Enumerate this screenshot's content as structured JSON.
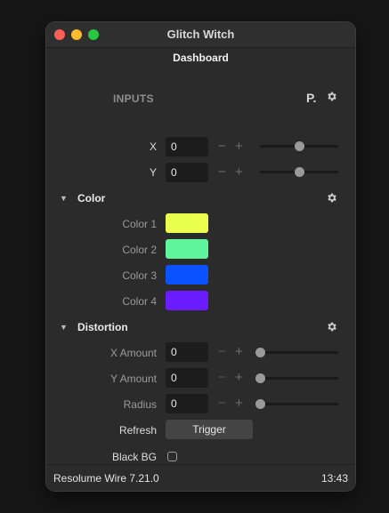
{
  "window": {
    "title": "Glitch Witch"
  },
  "tab": {
    "title": "Dashboard"
  },
  "inputs": {
    "header": "INPUTS",
    "p_label": "P.",
    "x": {
      "label": "X",
      "value": "0",
      "minus": "−",
      "plus": "+",
      "slider_fraction": 0.5
    },
    "y": {
      "label": "Y",
      "value": "0",
      "minus": "−",
      "plus": "+",
      "slider_fraction": 0.5
    }
  },
  "color_section": {
    "title": "Color",
    "items": [
      {
        "label": "Color 1",
        "color": "#ebff4d"
      },
      {
        "label": "Color 2",
        "color": "#5ff59a"
      },
      {
        "label": "Color 3",
        "color": "#0a52ff"
      },
      {
        "label": "Color 4",
        "color": "#6a1cff"
      }
    ]
  },
  "distortion_section": {
    "title": "Distortion",
    "x_amount": {
      "label": "X Amount",
      "value": "0",
      "minus": "−",
      "plus": "+",
      "slider_fraction": 0.0
    },
    "y_amount": {
      "label": "Y Amount",
      "value": "0",
      "minus": "−",
      "plus": "+",
      "slider_fraction": 0.0
    },
    "radius": {
      "label": "Radius",
      "value": "0",
      "minus": "−",
      "plus": "+",
      "slider_fraction": 0.0
    },
    "refresh": {
      "label": "Refresh",
      "button": "Trigger"
    },
    "black_bg": {
      "label": "Black BG",
      "checked": false
    }
  },
  "status": {
    "app": "Resolume Wire 7.21.0",
    "time": "13:43"
  },
  "icons": {
    "gear": "gear-icon",
    "triangle": "triangle-down-icon"
  }
}
